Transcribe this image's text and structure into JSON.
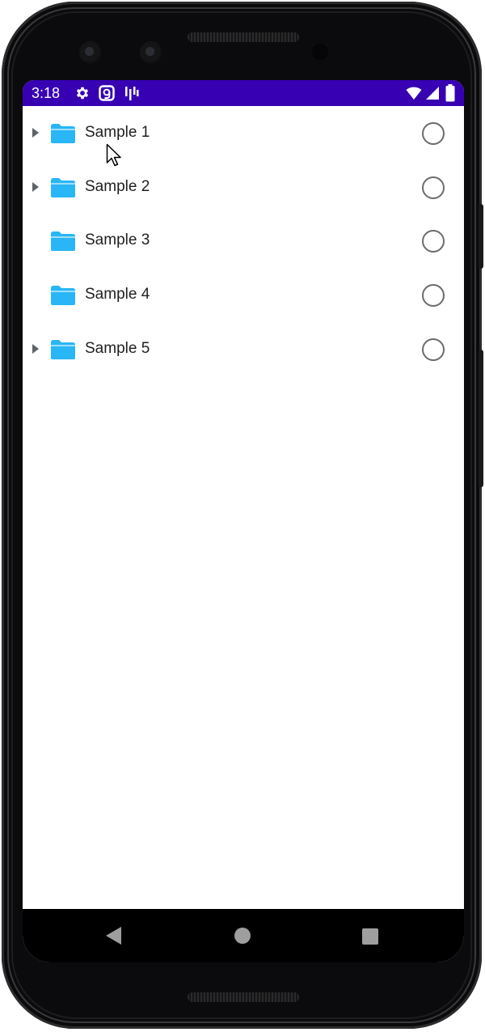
{
  "status_bar": {
    "time": "3:18",
    "color": "#3700b3",
    "left_icons": [
      "settings-gear-icon",
      "g-badge-icon",
      "signal-bars-icon"
    ],
    "right_icons": [
      "wifi-icon",
      "cellular-icon",
      "battery-icon"
    ]
  },
  "list": {
    "items": [
      {
        "label": "Sample 1",
        "expandable": true,
        "selected": false
      },
      {
        "label": "Sample 2",
        "expandable": true,
        "selected": false
      },
      {
        "label": "Sample 3",
        "expandable": false,
        "selected": false
      },
      {
        "label": "Sample 4",
        "expandable": false,
        "selected": false
      },
      {
        "label": "Sample 5",
        "expandable": true,
        "selected": false
      }
    ]
  },
  "colors": {
    "folder": "#29b6f6",
    "folder_tab": "#4fc3f7",
    "radio_border": "#6b6b6b",
    "expander": "#5f6368",
    "nav_icons": "#9e9e9e"
  },
  "nav_bar": {
    "buttons": [
      "back-icon",
      "home-icon",
      "recents-icon"
    ]
  }
}
